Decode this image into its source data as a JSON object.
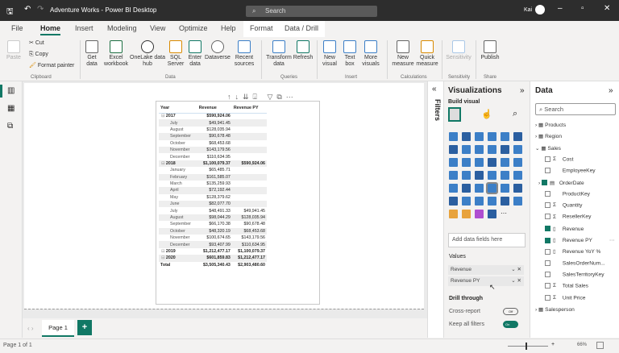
{
  "title": "Adventure Works - Power BI Desktop",
  "search_placeholder": "Search",
  "user": "Kai",
  "menu": [
    "File",
    "Home",
    "Insert",
    "Modeling",
    "View",
    "Optimize",
    "Help",
    "Format",
    "Data / Drill"
  ],
  "ribbon": {
    "paste": "Paste",
    "cut": "Cut",
    "copy": "Copy",
    "format_painter": "Format painter",
    "clipboard": "Clipboard",
    "get_data": "Get data",
    "excel": "Excel workbook",
    "onelake": "OneLake data hub",
    "sql": "SQL Server",
    "enter": "Enter data",
    "dataverse": "Dataverse",
    "recent": "Recent sources",
    "data_group": "Data",
    "transform": "Transform data",
    "refresh": "Refresh",
    "queries": "Queries",
    "new_visual": "New visual",
    "text_box": "Text box",
    "more_visuals": "More visuals",
    "insert": "Insert",
    "new_measure": "New measure",
    "quick_measure": "Quick measure",
    "calculations": "Calculations",
    "sensitivity": "Sensitivity",
    "sensitivity_group": "Sensitivity",
    "publish": "Publish",
    "share": "Share"
  },
  "table": {
    "headers": [
      "Year",
      "Revenue",
      "Revenue PY"
    ],
    "rows": [
      {
        "l": "2017",
        "r": "$590,924.06",
        "p": "",
        "y": 1
      },
      {
        "l": "July",
        "r": "$49,941.45",
        "p": ""
      },
      {
        "l": "August",
        "r": "$128,035.94",
        "p": ""
      },
      {
        "l": "September",
        "r": "$90,678.48",
        "p": ""
      },
      {
        "l": "October",
        "r": "$68,453.68",
        "p": ""
      },
      {
        "l": "November",
        "r": "$143,179.56",
        "p": ""
      },
      {
        "l": "December",
        "r": "$110,634.95",
        "p": ""
      },
      {
        "l": "2018",
        "r": "$1,100,079.37",
        "p": "$590,924.06",
        "y": 1
      },
      {
        "l": "January",
        "r": "$65,485.71",
        "p": ""
      },
      {
        "l": "February",
        "r": "$161,585.07",
        "p": ""
      },
      {
        "l": "March",
        "r": "$135,259.93",
        "p": ""
      },
      {
        "l": "April",
        "r": "$72,192.44",
        "p": ""
      },
      {
        "l": "May",
        "r": "$128,379.62",
        "p": ""
      },
      {
        "l": "June",
        "r": "$82,077.70",
        "p": ""
      },
      {
        "l": "July",
        "r": "$48,491.33",
        "p": "$49,941.45"
      },
      {
        "l": "August",
        "r": "$98,044.29",
        "p": "$128,035.94"
      },
      {
        "l": "September",
        "r": "$66,170.38",
        "p": "$90,678.48"
      },
      {
        "l": "October",
        "r": "$48,320.19",
        "p": "$68,453.68"
      },
      {
        "l": "November",
        "r": "$100,674.65",
        "p": "$143,179.56"
      },
      {
        "l": "December",
        "r": "$93,407.99",
        "p": "$110,634.95"
      },
      {
        "l": "2019",
        "r": "$1,212,477.17",
        "p": "$1,100,079.37",
        "y": 1
      },
      {
        "l": "2020",
        "r": "$601,859.83",
        "p": "$1,212,477.17",
        "y": 1
      },
      {
        "l": "Total",
        "r": "$3,505,340.43",
        "p": "$2,903,480.60",
        "t": 1
      }
    ]
  },
  "filters": "Filters",
  "viz": {
    "title": "Visualizations",
    "build": "Build visual",
    "add": "Add data fields here",
    "values": "Values",
    "wells": [
      "Revenue",
      "Revenue PY"
    ],
    "drill": "Drill through",
    "cross": "Cross-report",
    "cross_state": "Off",
    "keep": "Keep all filters",
    "keep_state": "On"
  },
  "data": {
    "title": "Data",
    "search": "Search",
    "items": [
      {
        "t": "Products",
        "k": "table"
      },
      {
        "t": "Region",
        "k": "table"
      },
      {
        "t": "Sales",
        "k": "table-open"
      },
      {
        "t": "Cost",
        "k": "sum"
      },
      {
        "t": "EmployeeKey",
        "k": ""
      },
      {
        "t": "OrderDate",
        "k": "date",
        "on": 1
      },
      {
        "t": "ProductKey",
        "k": ""
      },
      {
        "t": "Quantity",
        "k": "sum"
      },
      {
        "t": "ResellerKey",
        "k": "sum"
      },
      {
        "t": "Revenue",
        "k": "measure",
        "on": 1
      },
      {
        "t": "Revenue PY",
        "k": "measure",
        "on": 1
      },
      {
        "t": "Revenue YoY %",
        "k": "measure"
      },
      {
        "t": "SalesOrderNum...",
        "k": ""
      },
      {
        "t": "SalesTerritoryKey",
        "k": ""
      },
      {
        "t": "Total Sales",
        "k": "sum"
      },
      {
        "t": "Unit Price",
        "k": "sum"
      },
      {
        "t": "Salesperson",
        "k": "table"
      }
    ]
  },
  "page_tab": "Page 1",
  "status": "Page 1 of 1",
  "zoom": "66%",
  "accent": "#117865"
}
